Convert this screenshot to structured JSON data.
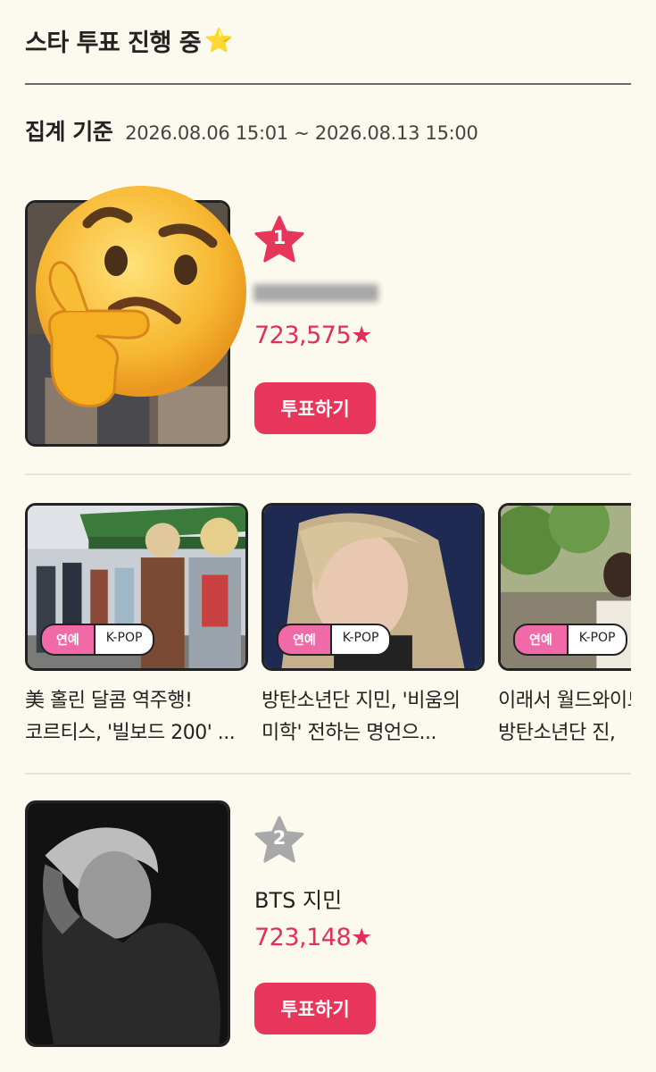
{
  "header": {
    "title": "스타 투표 진행 중",
    "title_icon": "star-emoji"
  },
  "period": {
    "label": "집계 기준",
    "range": "2026.08.06 15:01 ~ 2026.08.13 15:00"
  },
  "ranking": [
    {
      "rank": "1",
      "name": "",
      "votes": "723,575★",
      "vote_button": "투표하기",
      "star_color": "#e8365b",
      "thumbnail_overlay_icon": "thinking-face-icon"
    },
    {
      "rank": "2",
      "name": "BTS 지민",
      "votes": "723,148★",
      "vote_button": "투표하기",
      "star_color": "#a9a9a9"
    }
  ],
  "articles": [
    {
      "tag_category": "연예",
      "tag_genre": "K-POP",
      "title": "美 홀린 달콤 역주행! 코르티스, '빌보드 200' ..."
    },
    {
      "tag_category": "연예",
      "tag_genre": "K-POP",
      "title": "방탄소년단 지민, '비움의 미학' 전하는 명언으..."
    },
    {
      "tag_category": "연예",
      "tag_genre": "K-POP",
      "title": "이래서 월드와이드 방탄소년단 진,"
    }
  ],
  "colors": {
    "accent": "#e8365b",
    "vote_text": "#e0305a",
    "tag_pink": "#f06aa7",
    "background": "#fcf9ee"
  }
}
